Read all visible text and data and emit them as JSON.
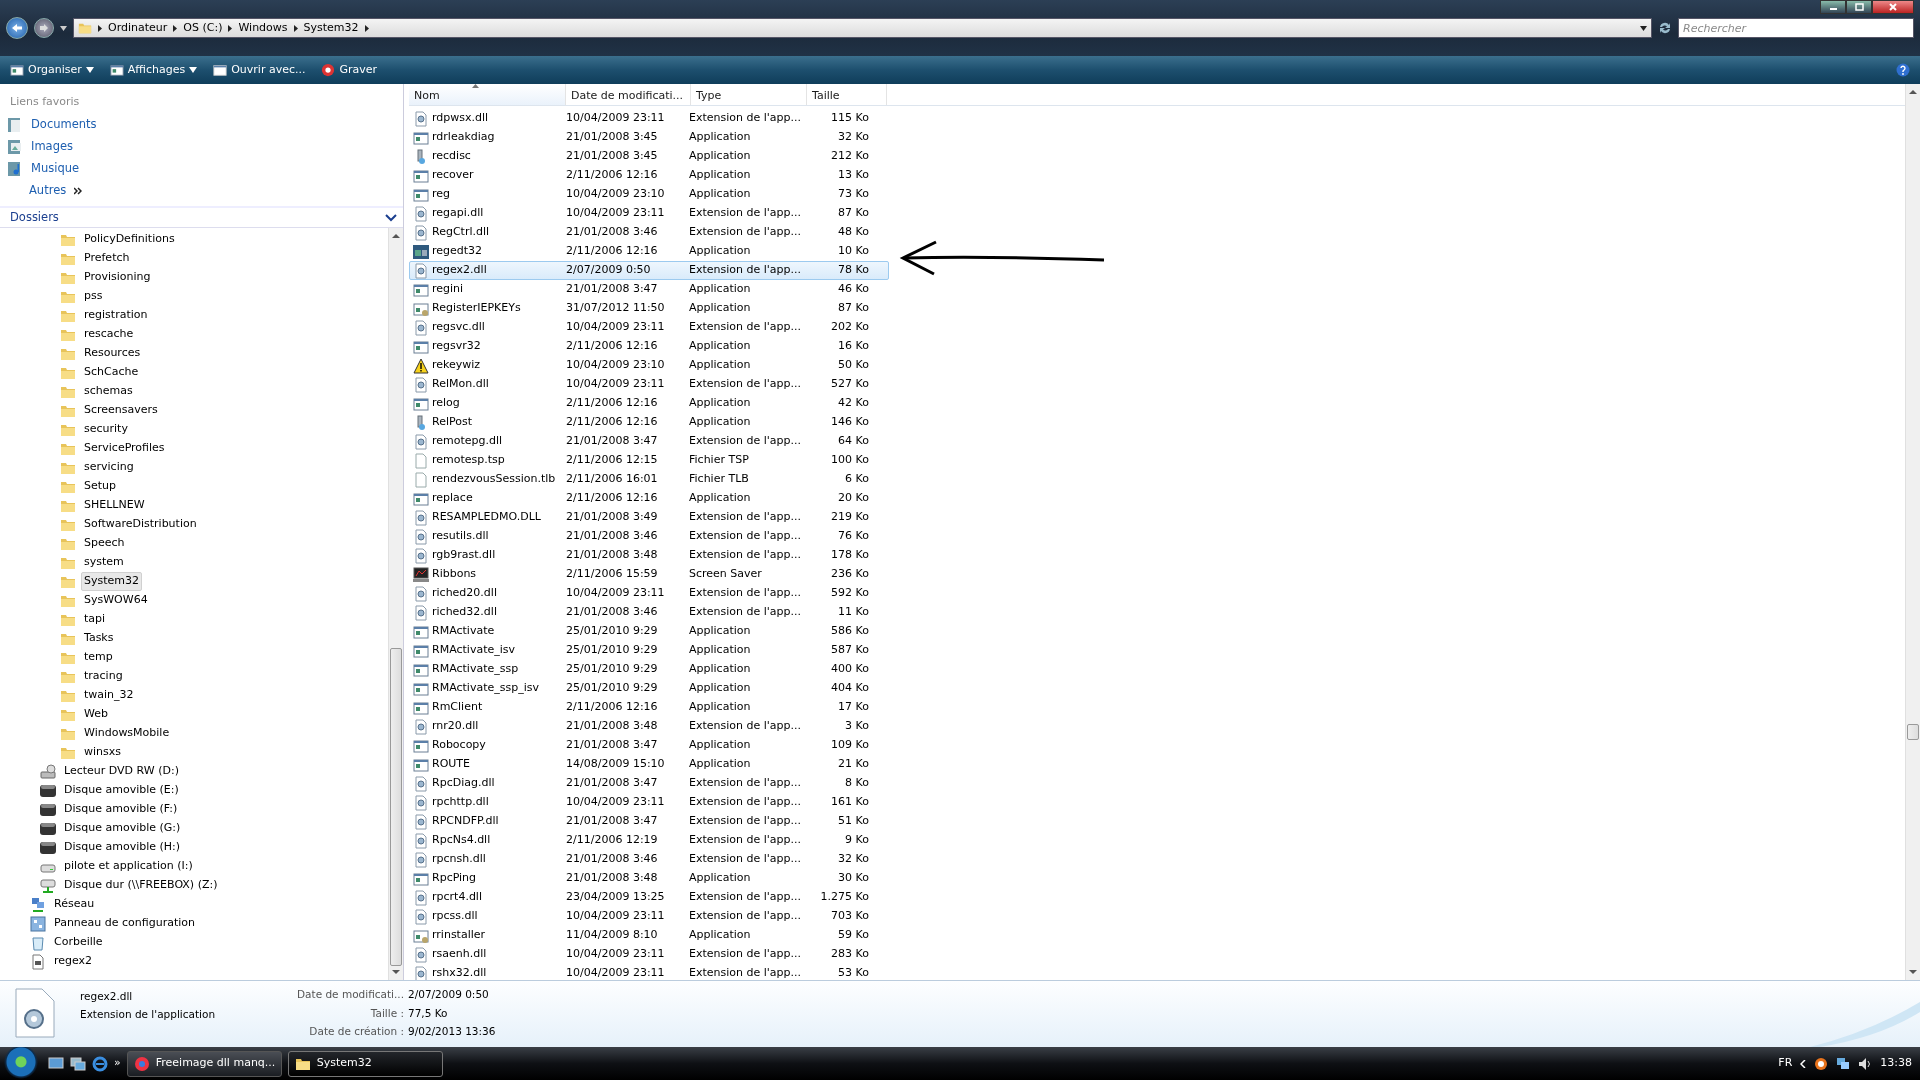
{
  "address_bar": {
    "crumbs": [
      "Ordinateur",
      "OS (C:)",
      "Windows",
      "System32"
    ]
  },
  "search": {
    "placeholder": "Rechercher"
  },
  "toolbar": [
    {
      "label": "Organiser",
      "kind": "menu"
    },
    {
      "label": "Affichages",
      "kind": "menu"
    },
    {
      "label": "Ouvrir avec...",
      "kind": "open"
    },
    {
      "label": "Graver",
      "kind": "burn"
    }
  ],
  "favorites": {
    "title": "Liens favoris",
    "links": [
      {
        "label": "Documents",
        "kind": "documents"
      },
      {
        "label": "Images",
        "kind": "images"
      },
      {
        "label": "Musique",
        "kind": "music"
      },
      {
        "label": "Autres",
        "kind": "more"
      }
    ]
  },
  "folders_header": "Dossiers",
  "tree": [
    {
      "children": [
        {
          "children": [
            {
              "children": [
                {
                  "label": "PolicyDefinitions",
                  "kind": "folder",
                  "selected": false
                },
                {
                  "label": "Prefetch",
                  "kind": "folder",
                  "selected": false
                },
                {
                  "label": "Provisioning",
                  "kind": "folder",
                  "selected": false
                },
                {
                  "label": "pss",
                  "kind": "folder",
                  "selected": false
                },
                {
                  "label": "registration",
                  "kind": "folder",
                  "selected": false
                },
                {
                  "label": "rescache",
                  "kind": "folder",
                  "selected": false
                },
                {
                  "label": "Resources",
                  "kind": "folder",
                  "selected": false
                },
                {
                  "label": "SchCache",
                  "kind": "folder",
                  "selected": false
                },
                {
                  "label": "schemas",
                  "kind": "folder",
                  "selected": false
                },
                {
                  "label": "Screensavers",
                  "kind": "folder",
                  "selected": false
                },
                {
                  "label": "security",
                  "kind": "folder",
                  "selected": false
                },
                {
                  "label": "ServiceProfiles",
                  "kind": "folder",
                  "selected": false
                },
                {
                  "label": "servicing",
                  "kind": "folder",
                  "selected": false
                },
                {
                  "label": "Setup",
                  "kind": "folder",
                  "selected": false
                },
                {
                  "label": "SHELLNEW",
                  "kind": "folder",
                  "selected": false
                },
                {
                  "label": "SoftwareDistribution",
                  "kind": "folder",
                  "selected": false
                },
                {
                  "label": "Speech",
                  "kind": "folder",
                  "selected": false
                },
                {
                  "label": "system",
                  "kind": "folder",
                  "selected": false
                },
                {
                  "label": "System32",
                  "kind": "folder",
                  "selected": true
                },
                {
                  "label": "SysWOW64",
                  "kind": "folder",
                  "selected": false
                },
                {
                  "label": "tapi",
                  "kind": "folder",
                  "selected": false
                },
                {
                  "label": "Tasks",
                  "kind": "folder",
                  "selected": false
                },
                {
                  "label": "temp",
                  "kind": "folder",
                  "selected": false
                },
                {
                  "label": "tracing",
                  "kind": "folder",
                  "selected": false
                },
                {
                  "label": "twain_32",
                  "kind": "folder",
                  "selected": false
                },
                {
                  "label": "Web",
                  "kind": "folder",
                  "selected": false
                },
                {
                  "label": "WindowsMobile",
                  "kind": "folder",
                  "selected": false
                },
                {
                  "label": "winsxs",
                  "kind": "folder",
                  "selected": false
                }
              ]
            }
          ]
        },
        {
          "label": "Lecteur DVD RW (D:)",
          "kind": "dvd",
          "selected": false
        },
        {
          "label": "Disque amovible (E:)",
          "kind": "removable",
          "selected": false
        },
        {
          "label": "Disque amovible (F:)",
          "kind": "removable",
          "selected": false
        },
        {
          "label": "Disque amovible (G:)",
          "kind": "removable",
          "selected": false
        },
        {
          "label": "Disque amovible (H:)",
          "kind": "removable",
          "selected": false
        },
        {
          "label": "pilote et application (I:)",
          "kind": "drive",
          "selected": false
        },
        {
          "label": "Disque dur (\\\\FREEBOX) (Z:)",
          "kind": "netdrive",
          "selected": false
        }
      ]
    },
    {
      "label": "Réseau",
      "kind": "network",
      "selected": false
    },
    {
      "label": "Panneau de configuration",
      "kind": "control",
      "selected": false
    },
    {
      "label": "Corbeille",
      "kind": "trash",
      "selected": false
    },
    {
      "label": "regex2",
      "kind": "file",
      "selected": false
    }
  ],
  "columns": [
    "Nom",
    "Date de modificati...",
    "Type",
    "Taille"
  ],
  "files": [
    {
      "name": "rdpwsx.dll",
      "date": "10/04/2009 23:11",
      "type": "Extension de l'app...",
      "size": "115 Ko",
      "kind": "dll",
      "selected": false
    },
    {
      "name": "rdrleakdiag",
      "date": "21/01/2008 3:45",
      "type": "Application",
      "size": "32 Ko",
      "kind": "app",
      "selected": false
    },
    {
      "name": "recdisc",
      "date": "21/01/2008 3:45",
      "type": "Application",
      "size": "212 Ko",
      "kind": "tool",
      "selected": false
    },
    {
      "name": "recover",
      "date": "2/11/2006 12:16",
      "type": "Application",
      "size": "13 Ko",
      "kind": "app",
      "selected": false
    },
    {
      "name": "reg",
      "date": "10/04/2009 23:10",
      "type": "Application",
      "size": "73 Ko",
      "kind": "app",
      "selected": false
    },
    {
      "name": "regapi.dll",
      "date": "10/04/2009 23:11",
      "type": "Extension de l'app...",
      "size": "87 Ko",
      "kind": "dll",
      "selected": false
    },
    {
      "name": "RegCtrl.dll",
      "date": "21/01/2008 3:46",
      "type": "Extension de l'app...",
      "size": "48 Ko",
      "kind": "dll",
      "selected": false
    },
    {
      "name": "regedt32",
      "date": "2/11/2006 12:16",
      "type": "Application",
      "size": "10 Ko",
      "kind": "regedit",
      "selected": false
    },
    {
      "name": "regex2.dll",
      "date": "2/07/2009 0:50",
      "type": "Extension de l'app...",
      "size": "78 Ko",
      "kind": "dll",
      "selected": true
    },
    {
      "name": "regini",
      "date": "21/01/2008 3:47",
      "type": "Application",
      "size": "46 Ko",
      "kind": "app",
      "selected": false
    },
    {
      "name": "RegisterIEPKEYs",
      "date": "31/07/2012 11:50",
      "type": "Application",
      "size": "87 Ko",
      "kind": "setup",
      "selected": false
    },
    {
      "name": "regsvc.dll",
      "date": "10/04/2009 23:11",
      "type": "Extension de l'app...",
      "size": "202 Ko",
      "kind": "dll",
      "selected": false
    },
    {
      "name": "regsvr32",
      "date": "2/11/2006 12:16",
      "type": "Application",
      "size": "16 Ko",
      "kind": "app",
      "selected": false
    },
    {
      "name": "rekeywiz",
      "date": "10/04/2009 23:10",
      "type": "Application",
      "size": "50 Ko",
      "kind": "warning",
      "selected": false
    },
    {
      "name": "RelMon.dll",
      "date": "10/04/2009 23:11",
      "type": "Extension de l'app...",
      "size": "527 Ko",
      "kind": "dll",
      "selected": false
    },
    {
      "name": "relog",
      "date": "2/11/2006 12:16",
      "type": "Application",
      "size": "42 Ko",
      "kind": "app",
      "selected": false
    },
    {
      "name": "RelPost",
      "date": "2/11/2006 12:16",
      "type": "Application",
      "size": "146 Ko",
      "kind": "tool",
      "selected": false
    },
    {
      "name": "remotepg.dll",
      "date": "21/01/2008 3:47",
      "type": "Extension de l'app...",
      "size": "64 Ko",
      "kind": "dll",
      "selected": false
    },
    {
      "name": "remotesp.tsp",
      "date": "2/11/2006 12:15",
      "type": "Fichier TSP",
      "size": "100 Ko",
      "kind": "blank",
      "selected": false
    },
    {
      "name": "rendezvousSession.tlb",
      "date": "2/11/2006 16:01",
      "type": "Fichier TLB",
      "size": "6 Ko",
      "kind": "blank",
      "selected": false
    },
    {
      "name": "replace",
      "date": "2/11/2006 12:16",
      "type": "Application",
      "size": "20 Ko",
      "kind": "app",
      "selected": false
    },
    {
      "name": "RESAMPLEDMO.DLL",
      "date": "21/01/2008 3:49",
      "type": "Extension de l'app...",
      "size": "219 Ko",
      "kind": "dll",
      "selected": false
    },
    {
      "name": "resutils.dll",
      "date": "21/01/2008 3:46",
      "type": "Extension de l'app...",
      "size": "76 Ko",
      "kind": "dll",
      "selected": false
    },
    {
      "name": "rgb9rast.dll",
      "date": "21/01/2008 3:48",
      "type": "Extension de l'app...",
      "size": "178 Ko",
      "kind": "dll",
      "selected": false
    },
    {
      "name": "Ribbons",
      "date": "2/11/2006 15:59",
      "type": "Screen Saver",
      "size": "236 Ko",
      "kind": "screensaver",
      "selected": false
    },
    {
      "name": "riched20.dll",
      "date": "10/04/2009 23:11",
      "type": "Extension de l'app...",
      "size": "592 Ko",
      "kind": "dll",
      "selected": false
    },
    {
      "name": "riched32.dll",
      "date": "21/01/2008 3:46",
      "type": "Extension de l'app...",
      "size": "11 Ko",
      "kind": "dll",
      "selected": false
    },
    {
      "name": "RMActivate",
      "date": "25/01/2010 9:29",
      "type": "Application",
      "size": "586 Ko",
      "kind": "app",
      "selected": false
    },
    {
      "name": "RMActivate_isv",
      "date": "25/01/2010 9:29",
      "type": "Application",
      "size": "587 Ko",
      "kind": "app",
      "selected": false
    },
    {
      "name": "RMActivate_ssp",
      "date": "25/01/2010 9:29",
      "type": "Application",
      "size": "400 Ko",
      "kind": "app",
      "selected": false
    },
    {
      "name": "RMActivate_ssp_isv",
      "date": "25/01/2010 9:29",
      "type": "Application",
      "size": "404 Ko",
      "kind": "app",
      "selected": false
    },
    {
      "name": "RmClient",
      "date": "2/11/2006 12:16",
      "type": "Application",
      "size": "17 Ko",
      "kind": "app",
      "selected": false
    },
    {
      "name": "rnr20.dll",
      "date": "21/01/2008 3:48",
      "type": "Extension de l'app...",
      "size": "3 Ko",
      "kind": "dll",
      "selected": false
    },
    {
      "name": "Robocopy",
      "date": "21/01/2008 3:47",
      "type": "Application",
      "size": "109 Ko",
      "kind": "app",
      "selected": false
    },
    {
      "name": "ROUTE",
      "date": "14/08/2009 15:10",
      "type": "Application",
      "size": "21 Ko",
      "kind": "app",
      "selected": false
    },
    {
      "name": "RpcDiag.dll",
      "date": "21/01/2008 3:47",
      "type": "Extension de l'app...",
      "size": "8 Ko",
      "kind": "dll",
      "selected": false
    },
    {
      "name": "rpchttp.dll",
      "date": "10/04/2009 23:11",
      "type": "Extension de l'app...",
      "size": "161 Ko",
      "kind": "dll",
      "selected": false
    },
    {
      "name": "RPCNDFP.dll",
      "date": "21/01/2008 3:47",
      "type": "Extension de l'app...",
      "size": "51 Ko",
      "kind": "dll",
      "selected": false
    },
    {
      "name": "RpcNs4.dll",
      "date": "2/11/2006 12:19",
      "type": "Extension de l'app...",
      "size": "9 Ko",
      "kind": "dll",
      "selected": false
    },
    {
      "name": "rpcnsh.dll",
      "date": "21/01/2008 3:46",
      "type": "Extension de l'app...",
      "size": "32 Ko",
      "kind": "dll",
      "selected": false
    },
    {
      "name": "RpcPing",
      "date": "21/01/2008 3:48",
      "type": "Application",
      "size": "30 Ko",
      "kind": "app",
      "selected": false
    },
    {
      "name": "rpcrt4.dll",
      "date": "23/04/2009 13:25",
      "type": "Extension de l'app...",
      "size": "1.275 Ko",
      "kind": "dll",
      "selected": false
    },
    {
      "name": "rpcss.dll",
      "date": "10/04/2009 23:11",
      "type": "Extension de l'app...",
      "size": "703 Ko",
      "kind": "dll",
      "selected": false
    },
    {
      "name": "rrinstaller",
      "date": "11/04/2009 8:10",
      "type": "Application",
      "size": "59 Ko",
      "kind": "setup",
      "selected": false
    },
    {
      "name": "rsaenh.dll",
      "date": "10/04/2009 23:11",
      "type": "Extension de l'app...",
      "size": "283 Ko",
      "kind": "dll",
      "selected": false
    },
    {
      "name": "rshx32.dll",
      "date": "10/04/2009 23:11",
      "type": "Extension de l'app...",
      "size": "53 Ko",
      "kind": "dll",
      "selected": false
    }
  ],
  "details": {
    "name": "regex2.dll",
    "type": "Extension de l'application",
    "fields": [
      {
        "label": "Date de modificati...",
        "value": "2/07/2009 0:50"
      },
      {
        "label": "Taille :",
        "value": "77,5 Ko"
      },
      {
        "label": "Date de création :",
        "value": "9/02/2013 13:36"
      }
    ]
  },
  "taskbar": {
    "more": "»",
    "tasks": [
      {
        "label": "Freeimage dll manq...",
        "kind": "browser",
        "selected": false
      },
      {
        "label": "System32",
        "kind": "folder",
        "selected": true
      }
    ],
    "language": "FR",
    "time": "13:38"
  }
}
